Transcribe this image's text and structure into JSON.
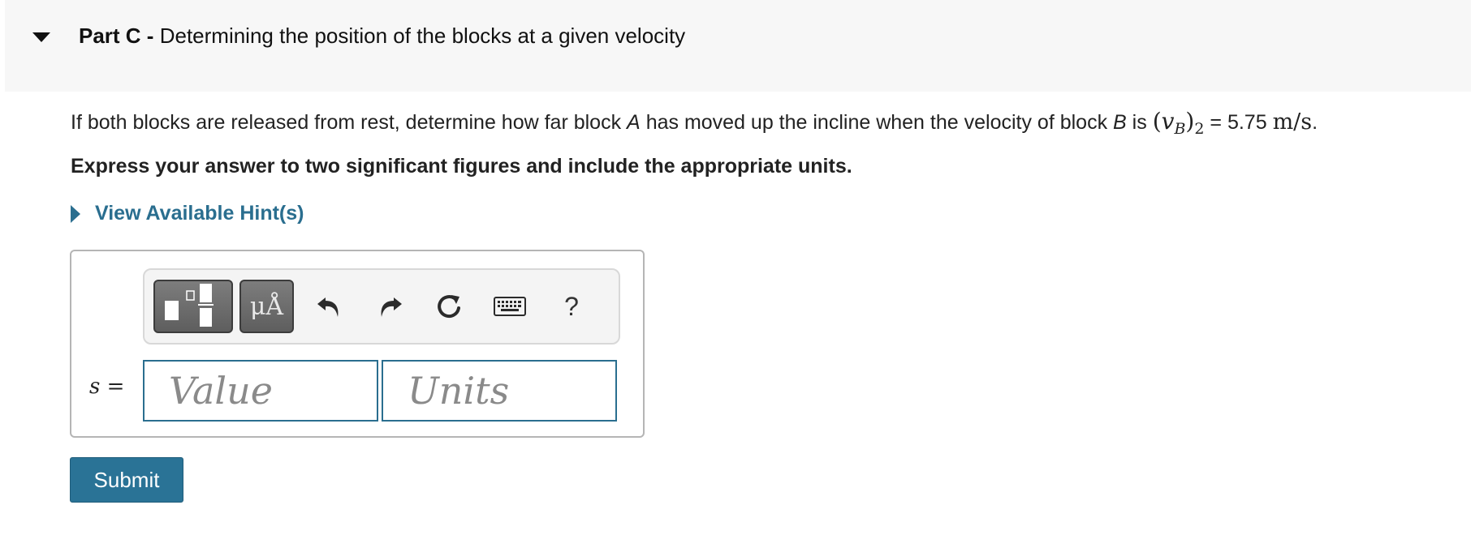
{
  "part": {
    "label": "Part C -",
    "title": "Determining the position of the blocks at a given velocity"
  },
  "question": {
    "text_before": "If both blocks are released from rest, determine how far block",
    "block_a": "A",
    "text_middle": "has moved up the incline when the velocity of block",
    "block_b": "B",
    "text_is": "is",
    "math_open": "(",
    "math_var": "v",
    "math_sub_b": "B",
    "math_close": ")",
    "math_sub_2": "2",
    "equals_value": "= 5.75",
    "unit": "m/s",
    "period": "."
  },
  "instructions": "Express your answer to two significant figures and include the appropriate units.",
  "hints": {
    "label": "View Available Hint(s)"
  },
  "toolbar": {
    "units_symbol": "μÅ",
    "help": "?",
    "icons": [
      "templates-icon",
      "units-icon",
      "undo-icon",
      "redo-icon",
      "reset-icon",
      "keyboard-icon",
      "help-icon"
    ]
  },
  "answer": {
    "variable": "s",
    "equals": "=",
    "value_placeholder": "Value",
    "units_placeholder": "Units"
  },
  "submit_label": "Submit",
  "colors": {
    "accent": "#2a7396",
    "link": "#2a6e8f",
    "header_bg": "#f7f7f7"
  }
}
